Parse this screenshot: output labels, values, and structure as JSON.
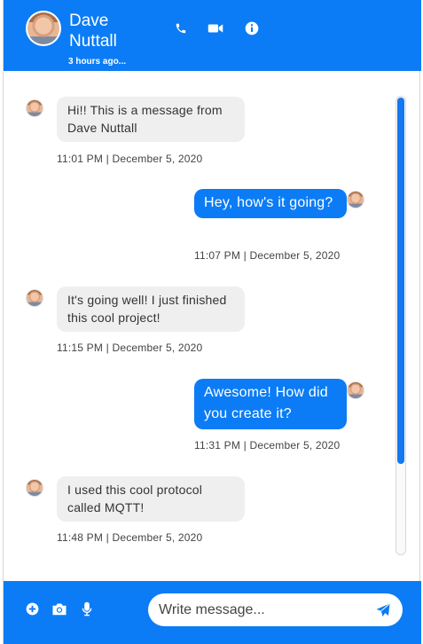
{
  "header": {
    "contact_name": "Dave Nuttall",
    "last_seen": "3 hours ago...",
    "icons": [
      "phone-icon",
      "video-camera-icon",
      "info-icon"
    ]
  },
  "messages": [
    {
      "direction": "incoming",
      "text": "Hi!! This is a message from Dave Nuttall",
      "timestamp": "11:01 PM | December 5, 2020"
    },
    {
      "direction": "outgoing",
      "text": "Hey, how's it going?",
      "timestamp": "11:07 PM | December 5, 2020"
    },
    {
      "direction": "incoming",
      "text": "It's going well! I just finished this cool project!",
      "timestamp": "11:15 PM | December 5, 2020"
    },
    {
      "direction": "outgoing",
      "text": "Awesome! How did you create it?",
      "timestamp": "11:31 PM | December 5, 2020"
    },
    {
      "direction": "incoming",
      "text": "I used this cool protocol called MQTT!",
      "timestamp": "11:48 PM | December 5, 2020"
    }
  ],
  "composer": {
    "placeholder": "Write message...",
    "value": "",
    "icons": [
      "add-icon",
      "camera-icon",
      "microphone-icon",
      "send-icon"
    ]
  },
  "colors": {
    "accent": "#0b7cf5",
    "incoming_bubble": "#efefef",
    "outgoing_bubble": "#0b7cf5"
  }
}
